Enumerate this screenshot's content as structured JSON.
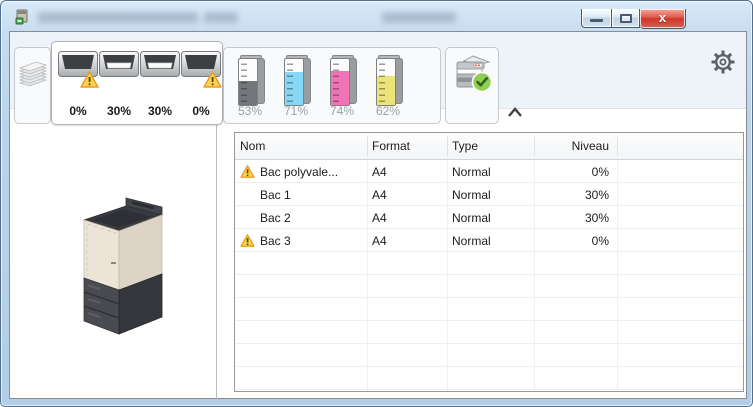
{
  "window": {
    "title_redacted": true
  },
  "toolbar": {
    "trays_tab": {
      "items": [
        {
          "level": "0%",
          "warning": true,
          "has_paper": false
        },
        {
          "level": "30%",
          "warning": false,
          "has_paper": true
        },
        {
          "level": "30%",
          "warning": false,
          "has_paper": true
        },
        {
          "level": "0%",
          "warning": true,
          "has_paper": false
        }
      ]
    },
    "toner_tab": {
      "items": [
        {
          "name": "black",
          "level": "53%",
          "pct": 53,
          "hex": "#73767a"
        },
        {
          "name": "cyan",
          "level": "71%",
          "pct": 71,
          "hex": "#85d7f4"
        },
        {
          "name": "magenta",
          "level": "74%",
          "pct": 74,
          "hex": "#f073b6"
        },
        {
          "name": "yellow",
          "level": "62%",
          "pct": 62,
          "hex": "#ebe478"
        }
      ]
    },
    "printer_status_ok": true
  },
  "tray_table": {
    "columns": [
      "Nom",
      "Format",
      "Type",
      "Niveau"
    ],
    "rows": [
      {
        "name": "Bac polyvale...",
        "format": "A4",
        "type": "Normal",
        "level": "0%",
        "warning": true
      },
      {
        "name": "Bac 1",
        "format": "A4",
        "type": "Normal",
        "level": "30%",
        "warning": false
      },
      {
        "name": "Bac 2",
        "format": "A4",
        "type": "Normal",
        "level": "30%",
        "warning": false
      },
      {
        "name": "Bac 3",
        "format": "A4",
        "type": "Normal",
        "level": "0%",
        "warning": true
      }
    ]
  },
  "colors": {
    "warning_fill": "#ffd24d",
    "warning_border": "#e79b22",
    "status_ok_green": "#8fce52",
    "close_button_red": "#d54f43",
    "aero_blue": "#bcd4ea"
  }
}
